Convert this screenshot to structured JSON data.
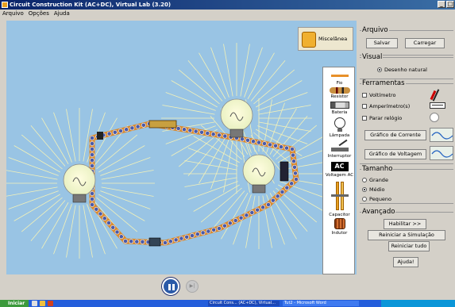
{
  "window": {
    "title": "Circuit Construction Kit (AC+DC), Virtual Lab (3.20)",
    "minimize_label": "_",
    "maximize_label": "□"
  },
  "menu": {
    "items": [
      "Arquivo",
      "Opções",
      "Ajuda"
    ]
  },
  "canvas": {
    "misc_label": "Miscelânea",
    "toolbox": {
      "wire": "Fio",
      "resistor": "Resistor",
      "battery": "Bateria",
      "bulb": "Lâmpada",
      "switch": "Interruptor",
      "ac_source": "Voltagem AC",
      "ac_badge": "AC",
      "capacitor": "Capacitor",
      "inductor": "Indutor"
    }
  },
  "panel": {
    "arquivo": {
      "title": "Arquivo",
      "save": "Salvar",
      "load": "Carregar"
    },
    "visual": {
      "title": "Visual",
      "mode": "Desenho natural"
    },
    "ferramentas": {
      "title": "Ferramentas",
      "voltmeter": "Voltímetro",
      "ammeter": "Amperímetro(s)",
      "stopwatch": "Parar relógio",
      "current_chart": "Gráfico de Corrente",
      "voltage_chart": "Gráfico de Voltagem"
    },
    "tamanho": {
      "title": "Tamanho",
      "options": [
        "Grande",
        "Médio",
        "Pequeno"
      ],
      "selected": "Médio"
    },
    "avancado": {
      "title": "Avançado",
      "enable": "Habilitar >>",
      "restart_sim": "Reiniciar a Simulação",
      "restart_all": "Reiniciar tudo",
      "help": "Ajuda!"
    }
  },
  "taskbar": {
    "start": "Iniciar",
    "items": [
      "Circuit Cons... (AC+DC), Virtual...",
      "Tut2 - Microsoft Word"
    ]
  }
}
